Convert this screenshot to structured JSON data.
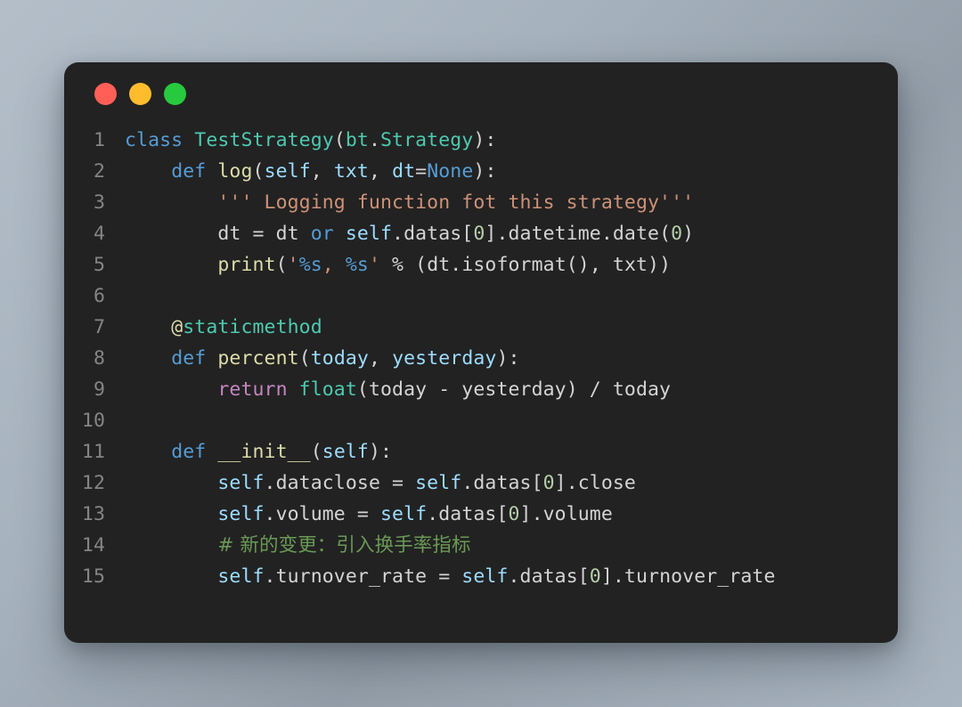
{
  "window": {
    "traffic_lights": [
      {
        "name": "close",
        "color": "#ff5f56"
      },
      {
        "name": "minimize",
        "color": "#ffbd2e"
      },
      {
        "name": "maximize",
        "color": "#27c93f"
      }
    ],
    "background_color": "#222222",
    "page_background": "#a6b2bd"
  },
  "editor": {
    "language": "python",
    "theme": "dark",
    "line_numbers": [
      "1",
      "2",
      "3",
      "4",
      "5",
      "6",
      "7",
      "8",
      "9",
      "10",
      "11",
      "12",
      "13",
      "14",
      "15"
    ],
    "lines": [
      {
        "number": "1",
        "text": "class TestStrategy(bt.Strategy):"
      },
      {
        "number": "2",
        "text": "    def log(self, txt, dt=None):"
      },
      {
        "number": "3",
        "text": "        ''' Logging function fot this strategy'''"
      },
      {
        "number": "4",
        "text": "        dt = dt or self.datas[0].datetime.date(0)"
      },
      {
        "number": "5",
        "text": "        print('%s, %s' % (dt.isoformat(), txt))"
      },
      {
        "number": "6",
        "text": ""
      },
      {
        "number": "7",
        "text": "    @staticmethod"
      },
      {
        "number": "8",
        "text": "    def percent(today, yesterday):"
      },
      {
        "number": "9",
        "text": "        return float(today - yesterday) / today"
      },
      {
        "number": "10",
        "text": ""
      },
      {
        "number": "11",
        "text": "    def __init__(self):"
      },
      {
        "number": "12",
        "text": "        self.dataclose = self.datas[0].close"
      },
      {
        "number": "13",
        "text": "        self.volume = self.datas[0].volume"
      },
      {
        "number": "14",
        "text": "        # 新的变更：引入换手率指标"
      },
      {
        "number": "15",
        "text": "        self.turnover_rate = self.datas[0].turnover_rate"
      }
    ],
    "tokens": {
      "l1": {
        "kw_class": "class",
        "cls_name": "TestStrategy",
        "paren_open": "(",
        "mod": "bt",
        "dot": ".",
        "base": "Strategy",
        "tail": "):"
      },
      "l2": {
        "indent": "    ",
        "kw_def": "def",
        "fn_name": "log",
        "paren_open": "(",
        "p1": "self",
        "sep1": ", ",
        "p2": "txt",
        "sep2": ", ",
        "p3": "dt",
        "eq": "=",
        "p4": "None",
        "tail": "):"
      },
      "l3": {
        "indent": "        ",
        "docstring": "''' Logging function fot this strategy'''"
      },
      "l4": {
        "indent": "        ",
        "lhs": "dt = dt ",
        "kw_or": "or",
        "sp": " ",
        "self": "self",
        "mid": ".datas[",
        "num": "0",
        "tail": "].datetime.date(",
        "num2": "0",
        "close": ")"
      },
      "l5": {
        "indent": "        ",
        "fn": "print",
        "paren": "(",
        "q1": "'",
        "pct1": "%s",
        "comma": ", ",
        "pct2": "%s",
        "q2": "'",
        "op": " % (",
        "rest": "dt.isoformat(), txt))"
      },
      "l7": {
        "indent": "    ",
        "at": "@",
        "name": "staticmethod"
      },
      "l8": {
        "indent": "    ",
        "kw_def": "def",
        "fn_name": "percent",
        "paren": "(",
        "p1": "today",
        "sep": ", ",
        "p2": "yesterday",
        "tail": "):"
      },
      "l9": {
        "indent": "        ",
        "kw_return": "return",
        "fn": "float",
        "paren": "(",
        "body": "today - yesterday) / today"
      },
      "l11": {
        "indent": "    ",
        "kw_def": "def",
        "fn_name": "__init__",
        "paren": "(",
        "p1": "self",
        "tail": "):"
      },
      "l12": {
        "indent": "        ",
        "self1": "self",
        "attr1": ".dataclose = ",
        "self2": "self",
        "mid": ".datas[",
        "num": "0",
        "tail": "].close"
      },
      "l13": {
        "indent": "        ",
        "self1": "self",
        "attr1": ".volume = ",
        "self2": "self",
        "mid": ".datas[",
        "num": "0",
        "tail": "].volume"
      },
      "l14": {
        "indent": "        ",
        "comment": "# 新的变更：引入换手率指标"
      },
      "l15": {
        "indent": "        ",
        "self1": "self",
        "attr1": ".turnover_rate = ",
        "self2": "self",
        "mid": ".datas[",
        "num": "0",
        "tail": "].turnover_rate"
      }
    }
  }
}
